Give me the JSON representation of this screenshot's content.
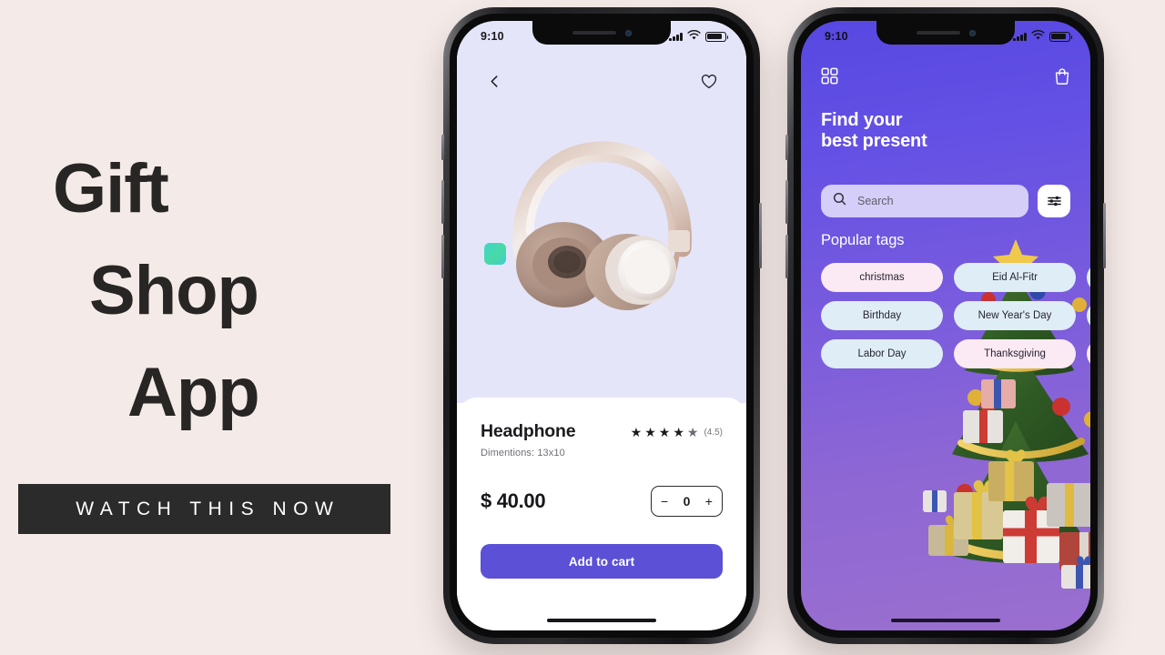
{
  "page": {
    "background_color": "#F4EBE8"
  },
  "promo": {
    "lines": [
      "Gift",
      "Shop",
      "App"
    ],
    "cta_label": "WATCH THIS NOW",
    "cta_background": "#2B2B2B",
    "text_color": "#282625"
  },
  "status_bar": {
    "time": "9:10",
    "signal_icon": "cellular-signal-icon",
    "wifi_icon": "wifi-icon",
    "battery_icon": "battery-icon"
  },
  "product_screen": {
    "back_icon": "chevron-left-icon",
    "favorite_icon": "heart-outline-icon",
    "hero_background": "#E5E5FA",
    "product_image": "headphone-product-image",
    "color_swatch": "teal-green-color-swatch",
    "title": "Headphone",
    "dimensions": "Dimentions: 13x10",
    "rating_stars": 5,
    "rating_value": "(4.5)",
    "price": "$ 40.00",
    "quantity": "0",
    "minus_label": "−",
    "plus_label": "+",
    "add_to_cart_label": "Add to cart",
    "accent_color": "#5B50D6"
  },
  "discover_screen": {
    "grid_icon": "grid-menu-icon",
    "bag_icon": "shopping-bag-icon",
    "heading_line1": "Find your",
    "heading_line2": "best present",
    "search_icon": "search-icon",
    "search_placeholder": "Search",
    "search_value": "",
    "filter_icon": "sliders-filter-icon",
    "popular_tags_title": "Popular tags",
    "tags": [
      {
        "label": "christmas",
        "color": "pink"
      },
      {
        "label": "Eid Al-Fitr",
        "color": "blue"
      },
      {
        "label": "",
        "color": "blue"
      },
      {
        "label": "Birthday",
        "color": "blue"
      },
      {
        "label": "New Year's Day",
        "color": "blue"
      },
      {
        "label": "",
        "color": "blue"
      },
      {
        "label": "Labor Day",
        "color": "blue"
      },
      {
        "label": "Thanksgiving",
        "color": "pink"
      },
      {
        "label": "",
        "color": "pink"
      }
    ],
    "decoration": "christmas-tree-with-gifts",
    "gradient_top": "#5748E2",
    "gradient_bottom": "#9A6FCF"
  }
}
